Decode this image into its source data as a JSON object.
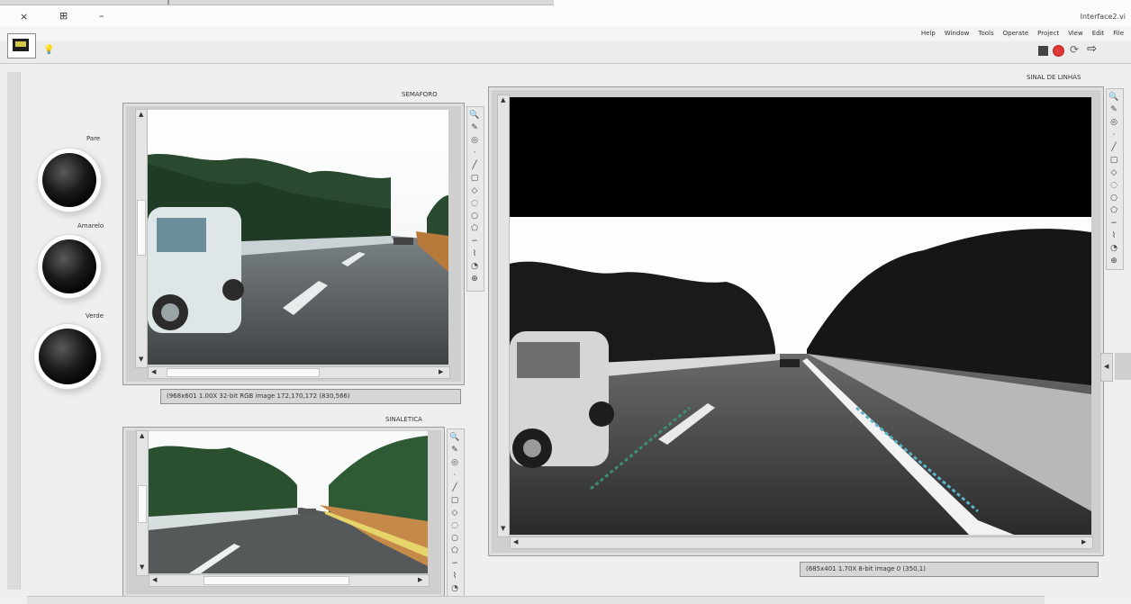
{
  "window": {
    "title": "Interface2.vi",
    "controls": [
      "×",
      "⊞",
      "–"
    ]
  },
  "menu": {
    "items": [
      "Help",
      "Window",
      "Tools",
      "Operate",
      "Project",
      "View",
      "Edit",
      "File"
    ]
  },
  "toolbar": {
    "run_arrow": "⇨"
  },
  "indicators": {
    "items": [
      {
        "label": "Pare"
      },
      {
        "label": "Amarelo"
      },
      {
        "label": "Verde"
      }
    ]
  },
  "semaforo": {
    "title": "SEMAFORO",
    "info": "(968x601 1.00X 32-bit RGB image 172,170,172   (830,566)"
  },
  "sinaletica": {
    "title": "SINALETICA"
  },
  "linhas": {
    "title": "SINAL DE LINHAS",
    "info": "(685x401 1.70X 8-bit image 0   (350,1)"
  },
  "icons": {
    "zoom": "zoom-icon",
    "pan": "pan-icon",
    "select": "selection-tool-icon",
    "roi": "roi-tool-icon"
  }
}
